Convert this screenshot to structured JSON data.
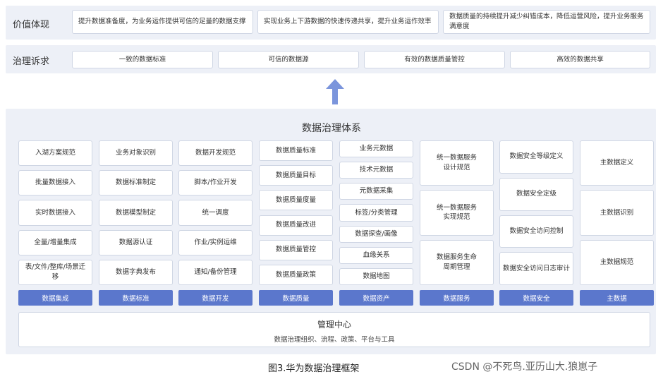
{
  "value_row": {
    "title": "价值体现",
    "items": [
      "提升数据准备度，为业务运作提供可信的足量的数据支撑",
      "实现业务上下游数据的快速传递共享，提升业务运作效率",
      "数据质量的持续提升减少纠错成本，降低运营风险，提升业务服务满意度"
    ]
  },
  "governance_row": {
    "title": "治理诉求",
    "items": [
      "一致的数据标准",
      "可信的数据源",
      "有效的数据质量管控",
      "高效的数据共享"
    ]
  },
  "system_title": "数据治理体系",
  "columns": [
    {
      "items": [
        "入湖方案规范",
        "批量数据接入",
        "实时数据接入",
        "全量/增量集成",
        "表/文件/整库/场景迁移"
      ],
      "footer": "数据集成"
    },
    {
      "items": [
        "业务对象识别",
        "数据标准制定",
        "数据模型制定",
        "数据源认证",
        "数据字典发布"
      ],
      "footer": "数据标准"
    },
    {
      "items": [
        "数据开发规范",
        "脚本/作业开发",
        "统一调度",
        "作业/实例运维",
        "通知/备份管理"
      ],
      "footer": "数据开发"
    },
    {
      "items": [
        "数据质量标准",
        "数据质量目标",
        "数据质量度量",
        "数据质量改进",
        "数据质量管控",
        "数据质量政策"
      ],
      "footer": "数据质量"
    },
    {
      "items": [
        "业务元数据",
        "技术元数据",
        "元数据采集",
        "标签/分类管理",
        "数据探查/画像",
        "血缘关系",
        "数据地图"
      ],
      "footer": "数据资产"
    },
    {
      "items": [
        "统一数据服务\n设计规范",
        "统一数据服务\n实现规范",
        "数据服务生命\n周期管理"
      ],
      "footer": "数据服务"
    },
    {
      "items": [
        "数据安全等级定义",
        "数据安全定级",
        "数据安全访问控制",
        "数据安全访问日志审计"
      ],
      "footer": "数据安全"
    },
    {
      "items": [
        "主数据定义",
        "主数据识别",
        "主数据规范"
      ],
      "footer": "主数据"
    }
  ],
  "management": {
    "title": "管理中心",
    "subtitle": "数据治理组织、流程、政策、平台与工具"
  },
  "caption": "图3.华为数据治理框架",
  "watermark": "CSDN @不死鸟.亚历山大.狼崽子",
  "colors": {
    "footer": "#5b77cc",
    "band": "#edf0f7",
    "arrow": "#7b95dc"
  }
}
